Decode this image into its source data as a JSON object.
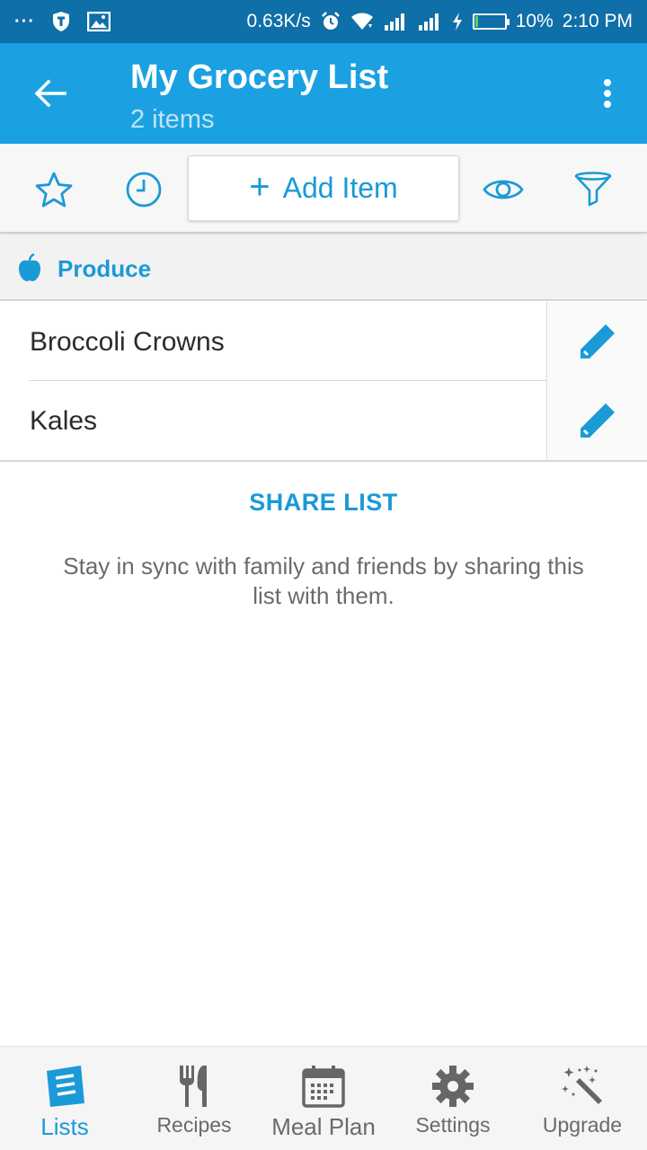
{
  "status_bar": {
    "dots": "···",
    "speed": "0.63K/s",
    "battery": "10%",
    "battery_level": 0.1,
    "time": "2:10 PM"
  },
  "app_bar": {
    "title": "My Grocery List",
    "subtitle": "2 items",
    "back_icon": "arrow-left-icon",
    "more_icon": "more-vert-icon"
  },
  "toolbar": {
    "favorite_icon": "star-icon",
    "history_icon": "clock-icon",
    "add_item_plus": "+",
    "add_item_label": "Add Item",
    "view_icon": "eye-icon",
    "filter_icon": "filter-icon"
  },
  "category": {
    "label": "Produce",
    "icon": "apple-icon"
  },
  "items": [
    {
      "name": "Broccoli Crowns",
      "edit_icon": "pencil-icon"
    },
    {
      "name": "Kales",
      "edit_icon": "pencil-icon"
    }
  ],
  "share": {
    "link_label": "SHARE LIST",
    "description": "Stay in sync with family and friends by sharing this list with them."
  },
  "bottom_nav": [
    {
      "label": "Lists",
      "icon": "lists-icon",
      "active": true
    },
    {
      "label": "Recipes",
      "icon": "fork-knife-icon",
      "active": false
    },
    {
      "label": "Meal Plan",
      "icon": "calendar-icon",
      "active": false
    },
    {
      "label": "Settings",
      "icon": "gear-icon",
      "active": false
    },
    {
      "label": "Upgrade",
      "icon": "magic-wand-icon",
      "active": false
    }
  ],
  "colors": {
    "status_bar": "#0f6fa8",
    "app_bar": "#1ba1e2",
    "accent": "#1a9ad6",
    "battery_fill": "#5ad15a"
  }
}
